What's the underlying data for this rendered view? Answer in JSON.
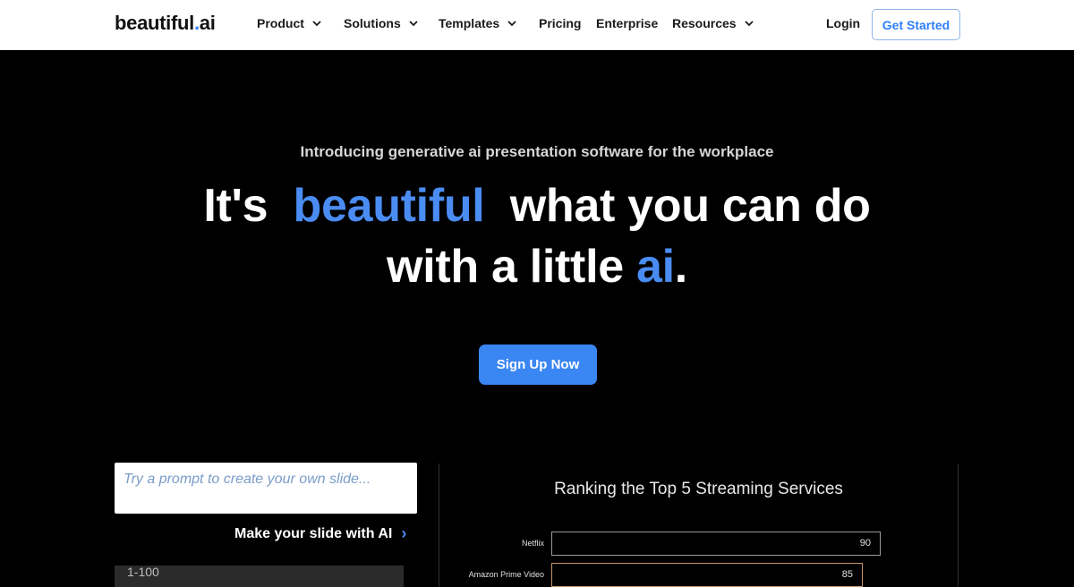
{
  "nav": {
    "logo_main": "beautiful",
    "logo_dot": ".",
    "logo_ai": "ai",
    "items": [
      {
        "label": "Product",
        "dropdown": true
      },
      {
        "label": "Solutions",
        "dropdown": true
      },
      {
        "label": "Templates",
        "dropdown": true
      },
      {
        "label": "Pricing",
        "dropdown": false
      },
      {
        "label": "Enterprise",
        "dropdown": false
      },
      {
        "label": "Resources",
        "dropdown": true
      }
    ],
    "login": "Login",
    "get_started": "Get Started"
  },
  "hero": {
    "subtitle": "Introducing generative ai presentation software for the workplace",
    "h1_part1": "It's",
    "h1_accent1": "beautiful",
    "h1_part2": "what you can do",
    "h1_part3": "with a little",
    "h1_accent2": "ai",
    "h1_end": ".",
    "signup": "Sign Up Now"
  },
  "prompt": {
    "placeholder": "Try a prompt to create your own slide...",
    "make_slide": "Make your slide with AI",
    "arrow": "›",
    "range": "1-100"
  },
  "chart_data": {
    "type": "bar",
    "title": "Ranking the Top 5 Streaming Services",
    "categories": [
      "Netflix",
      "Amazon Prime Video"
    ],
    "values": [
      90,
      85
    ],
    "bar_colors": [
      "#9a9a9a",
      "#c8956a"
    ]
  },
  "colors": {
    "accent": "#2f7ef6",
    "background": "#000000"
  }
}
